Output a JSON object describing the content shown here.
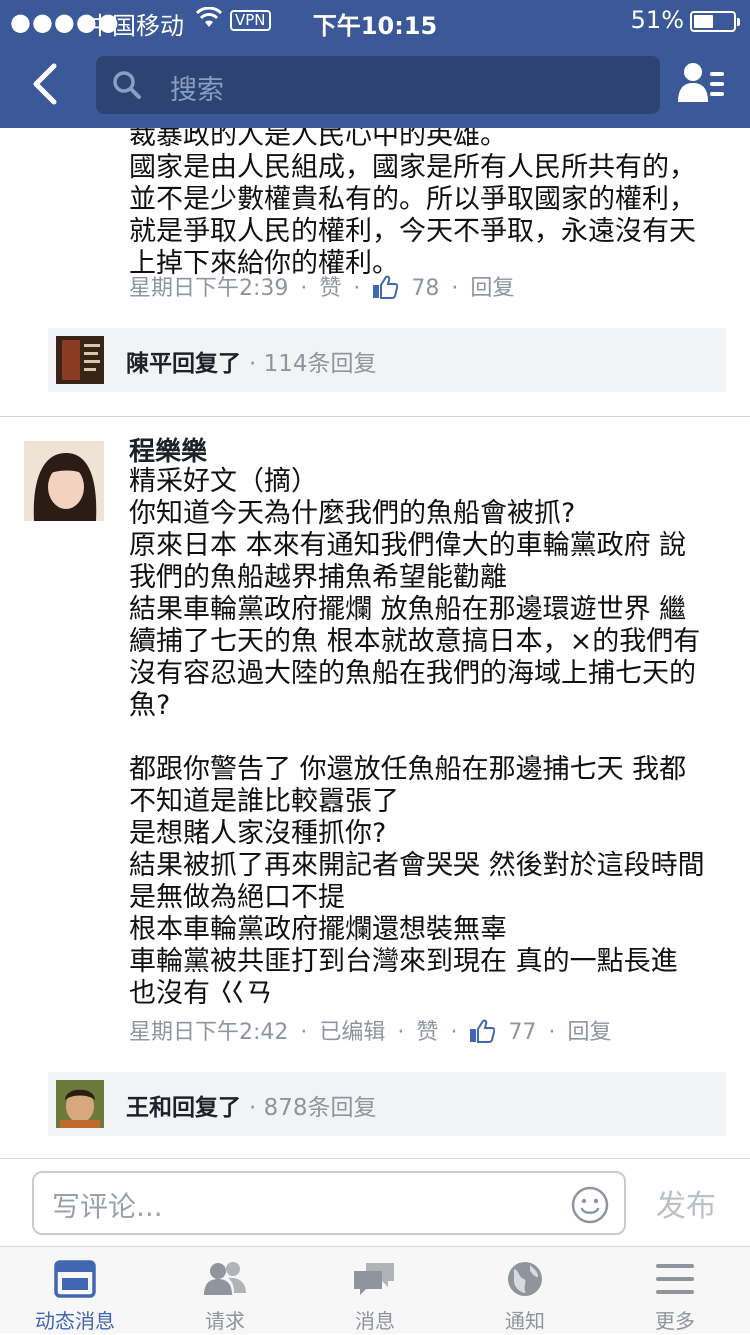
{
  "status_bar": {
    "signal": "●●●●●",
    "carrier": "中国移动",
    "vpn": "VPN",
    "time": "下午10:15",
    "battery_pct": "51%",
    "battery_level": 0.51
  },
  "header": {
    "search_placeholder": "搜索",
    "accent_color": "#3b5998"
  },
  "comments": [
    {
      "lines": [
        "裁暴政的人是人民心中的英雄。",
        "國家是由人民組成，國家是所有人民所共有的，",
        "並不是少數權貴私有的。所以爭取國家的權利，",
        "就是爭取人民的權利，今天不爭取，永遠沒有天",
        "上掉下來給你的權利。"
      ],
      "timestamp": "星期日下午2:39",
      "like_label": "赞",
      "likes": "78",
      "reply_label": "回复",
      "replies": {
        "name": "陳平回复了",
        "count": "· 114条回复"
      }
    },
    {
      "author": "程樂樂",
      "lines": [
        "精采好文（摘）",
        "你知道今天為什麼我們的魚船會被抓?",
        "原來日本 本來有通知我們偉大的車輪黨政府 說",
        "我們的魚船越界捕魚希望能勸離",
        "結果車輪黨政府擺爛  放魚船在那邊環遊世界 繼",
        "續捕了七天的魚 根本就故意搞日本，×的我們有",
        "沒有容忍過大陸的魚船在我們的海域上捕七天的",
        "魚?",
        "",
        "都跟你警告了 你還放任魚船在那邊捕七天  我都",
        "不知道是誰比較囂張了",
        "是想賭人家沒種抓你?",
        "結果被抓了再來開記者會哭哭 然後對於這段時間",
        "是無做為絕口不提",
        "根本車輪黨政府擺爛還想裝無辜",
        "車輪黨被共匪打到台灣來到現在  真的一點長進",
        "也沒有 巜ㄢ"
      ],
      "timestamp": "星期日下午2:42",
      "edited_label": "已编辑",
      "like_label": "赞",
      "likes": "77",
      "reply_label": "回复",
      "replies": {
        "name": "王和回复了",
        "count": "· 878条回复"
      }
    }
  ],
  "composer": {
    "placeholder": "写评论...",
    "post_label": "发布"
  },
  "tabs": [
    {
      "label": "动态消息",
      "icon": "news-feed-icon",
      "active": true
    },
    {
      "label": "请求",
      "icon": "friend-requests-icon",
      "active": false
    },
    {
      "label": "消息",
      "icon": "messages-icon",
      "active": false
    },
    {
      "label": "通知",
      "icon": "globe-notifications-icon",
      "active": false
    },
    {
      "label": "更多",
      "icon": "menu-icon",
      "active": false
    }
  ]
}
